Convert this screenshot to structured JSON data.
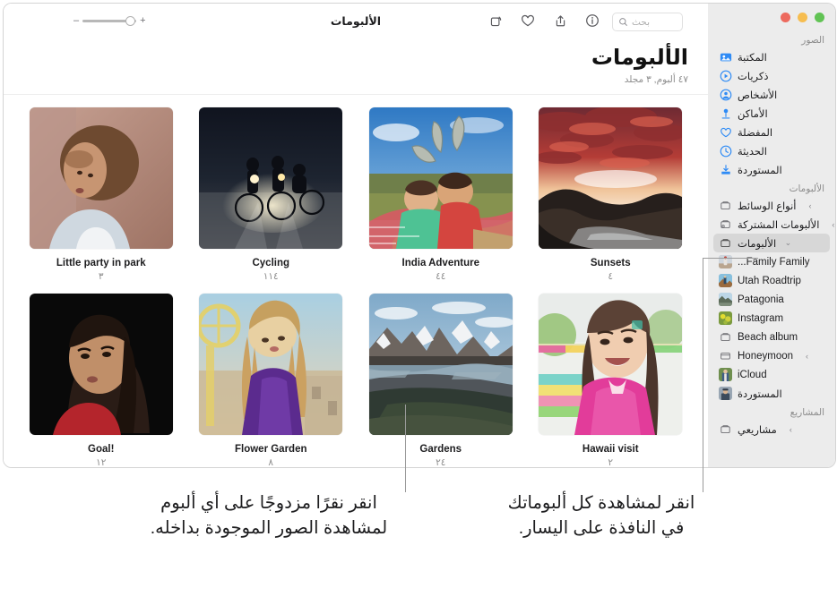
{
  "window": {
    "traffic_lights": [
      "green",
      "yellow",
      "red"
    ]
  },
  "toolbar": {
    "title": "الألبومات",
    "search_placeholder": "بحث",
    "search_value": "",
    "icons": [
      "rotate-icon",
      "heart-icon",
      "share-icon",
      "info-icon"
    ],
    "zoom_plus": "+",
    "zoom_minus": "–"
  },
  "header": {
    "title": "الألبومات",
    "subtitle": "٤٧ ألبوم, ٣ مجلد"
  },
  "sidebar": {
    "sections": [
      {
        "label": "الصور",
        "items": [
          {
            "label": "المكتبة",
            "icon": "library-icon"
          },
          {
            "label": "ذكريات",
            "icon": "memories-icon"
          },
          {
            "label": "الأشخاص",
            "icon": "people-icon"
          },
          {
            "label": "الأماكن",
            "icon": "places-icon"
          },
          {
            "label": "المفضلة",
            "icon": "heart-icon"
          },
          {
            "label": "الحديثة",
            "icon": "clock-icon"
          },
          {
            "label": "المستوردة",
            "icon": "import-icon"
          }
        ]
      },
      {
        "label": "الألبومات",
        "items": [
          {
            "label": "أنواع الوسائط",
            "icon": "folder-icon",
            "chevron": "›"
          },
          {
            "label": "الألبومات المشتركة",
            "icon": "shared-folder-icon",
            "chevron": "›"
          },
          {
            "label": "الألبومات",
            "icon": "folder-icon",
            "chevron": "⌄",
            "selected": true
          },
          {
            "label": "Family Family...",
            "icon": "album-thumb"
          },
          {
            "label": "Utah Roadtrip",
            "icon": "album-thumb"
          },
          {
            "label": "Patagonia",
            "icon": "album-thumb"
          },
          {
            "label": "Instagram",
            "icon": "album-thumb"
          },
          {
            "label": "Beach album",
            "icon": "album-icon"
          },
          {
            "label": "Honeymoon",
            "icon": "folder-icon",
            "chevron": "›"
          },
          {
            "label": "iCloud",
            "icon": "album-thumb"
          },
          {
            "label": "المستوردة",
            "icon": "album-thumb"
          }
        ]
      },
      {
        "label": "المشاريع",
        "items": [
          {
            "label": "مشاريعي",
            "icon": "folder-icon",
            "chevron": "›"
          }
        ]
      }
    ]
  },
  "albums": [
    {
      "name": "Little party in park",
      "count": "٣"
    },
    {
      "name": "Cycling",
      "count": "١١٤"
    },
    {
      "name": "India Adventure",
      "count": "٤٤"
    },
    {
      "name": "Sunsets",
      "count": "٤"
    },
    {
      "name": "Goal!",
      "count": "١٢"
    },
    {
      "name": "Flower Garden",
      "count": "٨"
    },
    {
      "name": "Gardens",
      "count": "٢٤"
    },
    {
      "name": "Hawaii visit",
      "count": "٢"
    }
  ],
  "callouts": {
    "left": "انقر نقرًا مزدوجًا على أي ألبوم لمشاهدة الصور الموجودة بداخله.",
    "right": "انقر لمشاهدة كل ألبوماتك في النافذة على اليسار."
  },
  "colors": {
    "accent": "#007aff",
    "sidebar_bg": "#ececec",
    "selected_row": "#d7d7d7",
    "secondary_text": "#8d8d8d"
  }
}
